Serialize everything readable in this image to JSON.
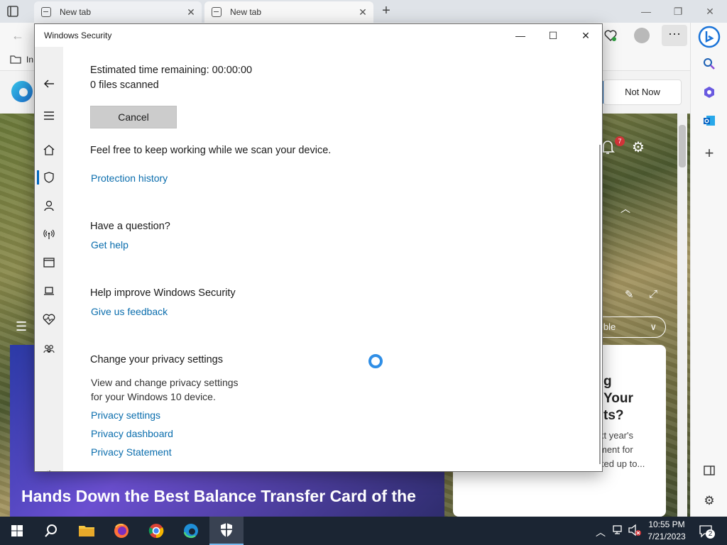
{
  "browser": {
    "tabs": [
      {
        "label": "New tab"
      },
      {
        "label": "New tab"
      }
    ],
    "favorites_partial": "In",
    "new_tab_page": {
      "not_now_label": "Not Now",
      "notification_count": "7",
      "visible_pill_label": "ible",
      "left_card_title": "Hands Down the Best Balance Transfer Card of the",
      "right_card_title_lines": [
        "g",
        "Your",
        "ts?"
      ],
      "right_card_sub_lines": [
        "xt year's",
        "ment for",
        "ked up to..."
      ]
    }
  },
  "windows_security": {
    "title": "Windows Security",
    "scan": {
      "estimated_time_label": "Estimated time remaining:  00:00:00",
      "files_scanned": "0  files scanned",
      "cancel_label": "Cancel",
      "keep_working_text": "Feel free to keep working while we scan your device.",
      "protection_history_link": "Protection history"
    },
    "question": {
      "heading": "Have a question?",
      "get_help_link": "Get help"
    },
    "improve": {
      "heading": "Help improve Windows Security",
      "feedback_link": "Give us feedback"
    },
    "privacy": {
      "heading": "Change your privacy settings",
      "description_line1": "View and change privacy settings",
      "description_line2": "for your Windows 10 device.",
      "links": [
        "Privacy settings",
        "Privacy dashboard",
        "Privacy Statement"
      ]
    },
    "nav_icons": [
      "back-icon",
      "menu-icon",
      "home-icon",
      "shield-icon",
      "account-icon",
      "network-icon",
      "app-browser-icon",
      "device-icon",
      "health-icon",
      "family-icon",
      "settings-icon"
    ]
  },
  "taskbar": {
    "time": "10:55 PM",
    "date": "7/21/2023",
    "notification_count": "2"
  },
  "colors": {
    "link": "#0a6dad",
    "accent": "#0067c0",
    "taskbar": "#1b2533"
  }
}
